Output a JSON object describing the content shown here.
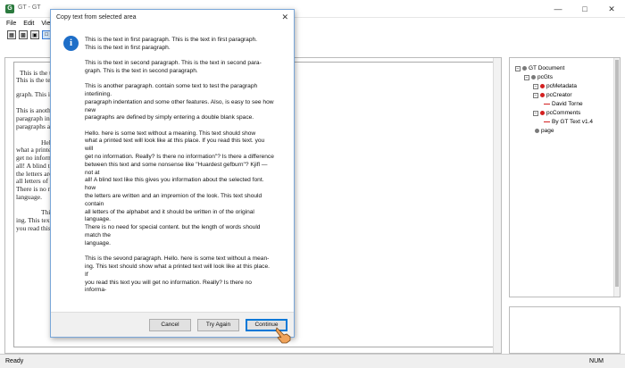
{
  "window": {
    "title": "GT - GT",
    "app_icon": "G"
  },
  "menu": {
    "items": [
      "File",
      "Edit",
      "View"
    ]
  },
  "document": {
    "lines": [
      "This is the text in first",
      "This is the text in",
      "graph. This is the text in",
      "This is another paragrap",
      "paragraph indentation an",
      "paragraphs are defined",
      "Hello. here is some",
      "what a printed text",
      "get no information.",
      "all! A blind text li",
      "the letters are writ",
      "all letters of the al",
      "There is no need for",
      "language.",
      "This is the seco",
      "ing. This text sho",
      "you read this text"
    ]
  },
  "tree": {
    "items": [
      {
        "label": "GT Document",
        "expander": "−",
        "marker": "gray"
      },
      {
        "label": "pcGts",
        "expander": "−",
        "marker": "gray"
      },
      {
        "label": "pcMetadata",
        "expander": "−",
        "marker": "red"
      },
      {
        "label": "pcCreator",
        "expander": "−",
        "marker": "red"
      },
      {
        "label": "David Torne",
        "expander": "",
        "marker": "line"
      },
      {
        "label": "pcComments",
        "expander": "−",
        "marker": "red"
      },
      {
        "label": "By GT Text v1.4",
        "expander": "",
        "marker": "line"
      },
      {
        "label": "page",
        "expander": "",
        "marker": "gray"
      }
    ]
  },
  "status": {
    "left": "Ready",
    "num": "NUM"
  },
  "dialog": {
    "title": "Copy text from selected area",
    "icon": "i",
    "paragraphs": [
      [
        "This is the text in first paragraph. This is the text in first paragraph.",
        "This is the text in first paragraph."
      ],
      [
        "This is the text in second paragraph. This is the text in second para-",
        "graph. This is the text in second paragraph."
      ],
      [
        "This is another paragraph. contain some text to test the paragraph",
        "interlining.",
        "paragraph indentation and some other features. Also, is easy to see how",
        "new",
        "paragraphs are defined by simply entering a double blank space."
      ],
      [
        "Hello. here is some text without a meaning. This text should show",
        "what a printed text will look like at this place. If you read this text. you",
        "will",
        "get no information. Really? Is there no information\"? Is there a difference",
        "between this text and some nonsense like \"Huardest gefburn\"? Kjifl —",
        "not at",
        "all! A blind text like this gives you information about the selected font.",
        "how",
        "the letters are written and an impremion of the look. This text should",
        "contain",
        "all letters of the alphabet and it should be written in of the original",
        "language.",
        "There is no need for special content. but the length of words should",
        "match the",
        "language."
      ],
      [
        "This is the sevond paragraph. Hello. here is some text without a mean-",
        "ing. This text should show what a printed text will look like at this place.",
        "If",
        "you read this text you will get no information. Really? Is there no",
        "informa-"
      ]
    ],
    "buttons": {
      "cancel": "Cancel",
      "retry": "Try Again",
      "continue": "Continue"
    }
  },
  "colors": {
    "accent": "#0078d7",
    "info_icon": "#1e6ec8",
    "tree_red": "#d32020"
  }
}
